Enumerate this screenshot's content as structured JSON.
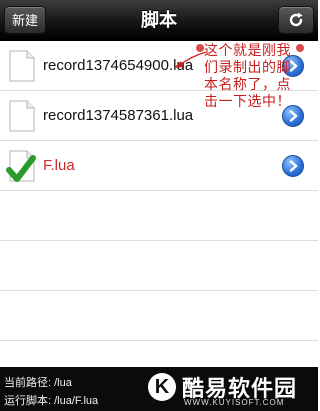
{
  "navbar": {
    "left_button": "新建",
    "title": "脚本",
    "refresh_icon": "refresh-icon"
  },
  "files": [
    {
      "name": "record1374654900.lua",
      "icon": "file-icon",
      "selected": false
    },
    {
      "name": "record1374587361.lua",
      "icon": "file-icon",
      "selected": false
    },
    {
      "name": "F.lua",
      "icon": "checkmark-icon",
      "selected": true
    }
  ],
  "annotation": {
    "text": "这个就是刚我们录制出的脚本名称了，点击一下选中！",
    "color": "#c81e1e"
  },
  "footer": {
    "current_path": "当前路径: /lua",
    "running_script": "运行脚本: /lua/F.lua"
  },
  "watermark": {
    "logo_letter": "K",
    "name": "酷易软件园",
    "url": "WWW.KUYISOFT.COM"
  },
  "colors": {
    "accent_blue": "#2a6fd6",
    "selected_text": "#cc2b2b",
    "check_green": "#2a9a2a"
  }
}
